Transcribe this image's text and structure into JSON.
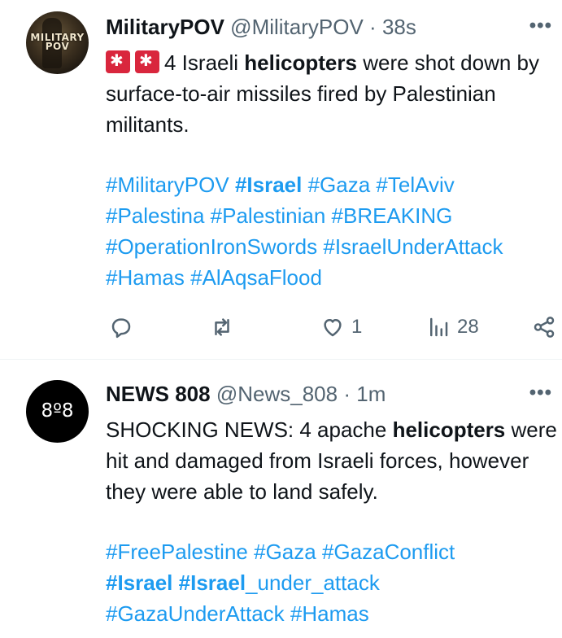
{
  "tweets": [
    {
      "display_name": "MilitaryPOV",
      "handle": "@MilitaryPOV",
      "separator": "·",
      "time": "38s",
      "avatar_text_1": "MILITARY",
      "avatar_text_2": "POV",
      "emoji": [
        "siren-emoji",
        "siren-emoji"
      ],
      "text_pre": "4 Israeli ",
      "text_bold": "helicopters",
      "text_post": " were shot down by surface-to-air missiles fired by Palestinian militants.",
      "hashtag_lines": [
        [
          {
            "t": "#MilitaryPOV",
            "b": false
          },
          {
            "t": "#Israel",
            "b": true
          },
          {
            "t": "#Gaza",
            "b": false
          },
          {
            "t": "#TelAviv",
            "b": false
          }
        ],
        [
          {
            "t": "#Palestina",
            "b": false
          },
          {
            "t": "#Palestinian",
            "b": false
          },
          {
            "t": "#BREAKING",
            "b": false
          }
        ],
        [
          {
            "t": "#OperationIronSwords",
            "b": false
          },
          {
            "t": "#IsraelUnderAttack",
            "b": false
          }
        ],
        [
          {
            "t": "#Hamas",
            "b": false
          },
          {
            "t": "#AlAqsaFlood",
            "b": false
          }
        ]
      ],
      "likes": "1",
      "views": "28"
    },
    {
      "display_name": "NEWS 808",
      "handle": "@News_808",
      "separator": "·",
      "time": "1m",
      "avatar_text": "8º8",
      "text_pre": "SHOCKING NEWS: 4 apache ",
      "text_bold": "helicopters",
      "text_post": " were hit and damaged from Israeli forces, however they were able to land safely.",
      "hashtag_lines": [
        [
          {
            "t": "#FreePalestine",
            "b": false
          },
          {
            "t": "#Gaza",
            "b": false
          },
          {
            "t": "#GazaConflict",
            "b": false
          }
        ],
        [
          {
            "t": "#Israel",
            "b": true
          },
          {
            "t": "#Israel",
            "b": true,
            "suffix": "_under_attack"
          }
        ],
        [
          {
            "t": "#GazaUnderAttack",
            "b": false
          },
          {
            "t": "#Hamas",
            "b": false
          }
        ]
      ]
    }
  ],
  "more_label": "•••",
  "colors": {
    "accent": "#1d9bf0",
    "secondary": "#536471",
    "text": "#0f1419"
  }
}
